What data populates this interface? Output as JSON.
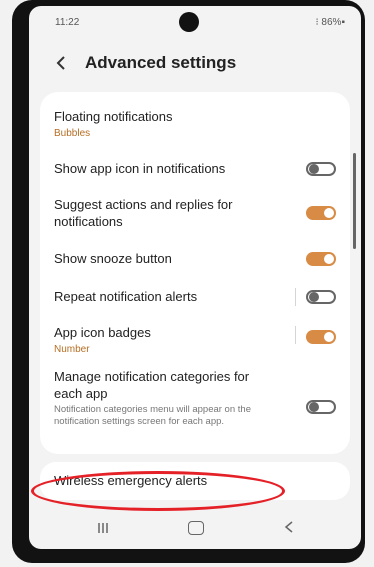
{
  "status_bar": {
    "time": "11:22",
    "status_icons": "⊙ ⁝ ⁝",
    "right": "⁝ 86%▪"
  },
  "header": {
    "title": "Advanced settings"
  },
  "settings": [
    {
      "title": "Floating notifications",
      "subtitle": "Bubbles"
    },
    {
      "title": "Show app icon in notifications",
      "toggle": "off"
    },
    {
      "title": "Suggest actions and replies for notifications",
      "toggle": "on"
    },
    {
      "title": "Show snooze button",
      "toggle": "on"
    },
    {
      "title": "Repeat notification alerts",
      "toggle": "off"
    },
    {
      "title": "App icon badges",
      "subtitle": "Number",
      "toggle": "on"
    },
    {
      "title": "Manage notification categories for each app",
      "description": "Notification categories menu will appear on the notification settings screen for each app.",
      "toggle": "off"
    }
  ],
  "wireless": {
    "title": "Wireless emergency alerts"
  },
  "colors": {
    "accent": "#d88b45",
    "subtitle": "#b66e23",
    "annotation": "#e52128"
  },
  "icons": {
    "back": "chevron-left-icon",
    "nav_recent": "recent-apps-icon",
    "nav_home": "home-icon",
    "nav_back": "back-icon"
  }
}
